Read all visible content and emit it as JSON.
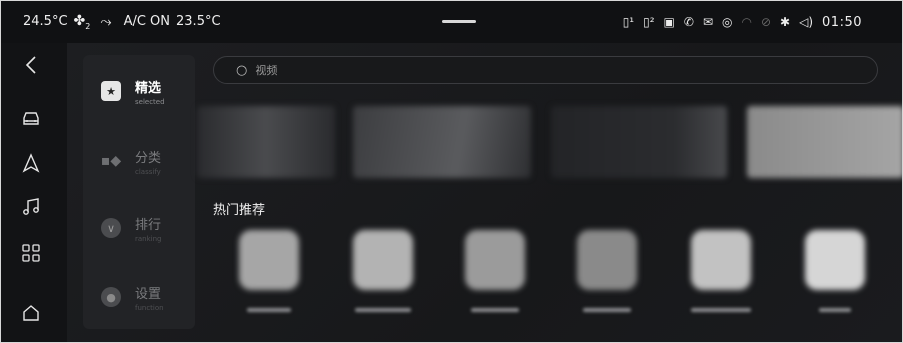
{
  "status": {
    "temp_out": "24.5°C",
    "fan_level": "2",
    "ac_label": "A/C ON",
    "ac_temp": "23.5°C",
    "time": "01:50",
    "icons": [
      "sim1-icon",
      "sim2-icon",
      "vibrate-icon",
      "call-icon",
      "mail-icon",
      "globe-icon",
      "wifi-icon",
      "link-icon",
      "bluetooth-icon",
      "volume-icon"
    ]
  },
  "nav": {
    "items": [
      "back-icon",
      "car-icon",
      "navigation-icon",
      "music-icon",
      "apps-icon",
      "home-icon"
    ]
  },
  "categories": [
    {
      "label": "精选",
      "sub": "selected",
      "icon": "star-icon"
    },
    {
      "label": "分类",
      "sub": "classify",
      "icon": "grid-icon"
    },
    {
      "label": "排行",
      "sub": "ranking",
      "icon": "chevron-icon"
    },
    {
      "label": "设置",
      "sub": "function",
      "icon": "settings-icon"
    }
  ],
  "search": {
    "placeholder": "视频"
  },
  "section": {
    "title": "热门推荐"
  },
  "banners": [
    {
      "color": "#4a4b4e"
    },
    {
      "color": "#5a5b5e"
    },
    {
      "color": "#2b2c2f"
    },
    {
      "color": "#9c9c9c"
    }
  ],
  "apps": [
    {
      "color": "#a6a6a6"
    },
    {
      "color": "#b3b3b3"
    },
    {
      "color": "#9b9b9b"
    },
    {
      "color": "#8a8a8a"
    },
    {
      "color": "#c2c2c2"
    },
    {
      "color": "#d6d6d6"
    }
  ],
  "colors": {
    "accent": "#ffffff",
    "background": "#141517"
  }
}
